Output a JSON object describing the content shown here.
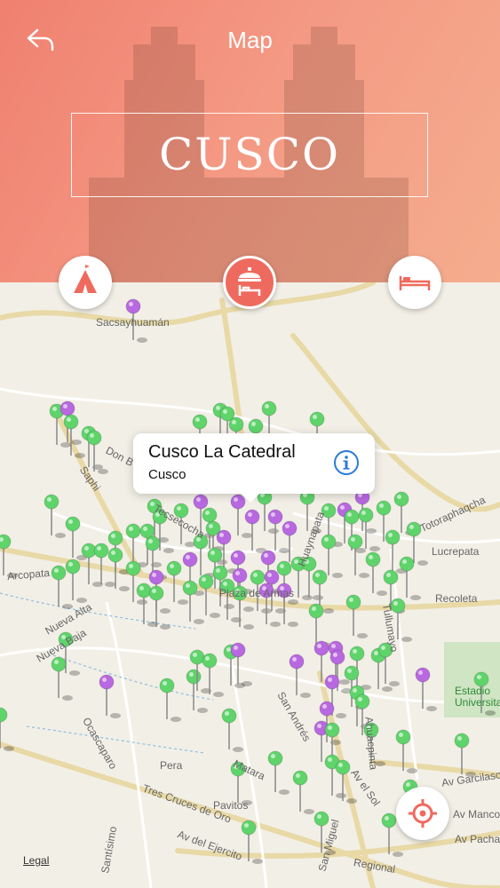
{
  "header": {
    "title": "Map",
    "city": "CUSCO",
    "back_icon": "back-arrow-icon"
  },
  "categories": [
    {
      "name": "attractions",
      "icon": "tent-icon",
      "active": false
    },
    {
      "name": "hotels-alt",
      "icon": "hotel-bell-icon",
      "active": true
    },
    {
      "name": "beds",
      "icon": "bed-icon",
      "active": false
    }
  ],
  "callout": {
    "title": "Cusco La Catedral",
    "subtitle": "Cusco",
    "info_icon": "info-icon"
  },
  "map": {
    "legal": "Legal",
    "place_labels": [
      "Sacsayhuamán",
      "Don B",
      "Saphi",
      "Arcopata",
      "Nueva Alta",
      "Nueva Baja",
      "Tecsecocha",
      "Plaza de Armas",
      "Huaynapata",
      "Tullumayo",
      "Recoleta",
      "Lucrepata",
      "Totoraphaqcha",
      "San Andrés",
      "Ocascaparo",
      "Pera",
      "Tres Cruces de Oro",
      "Pavitos",
      "Matara",
      "Av del Ejercito",
      "San Miguel",
      "Av el Sol",
      "Regional",
      "Av Garcilaso",
      "Av Manco",
      "Av Pacha",
      "Santísimo",
      "Ahuacpinta",
      "Estadio Universitario"
    ],
    "pin_colors": {
      "green": "#5fd46b",
      "purple": "#b868e0"
    },
    "locate_icon": "crosshair-icon"
  }
}
